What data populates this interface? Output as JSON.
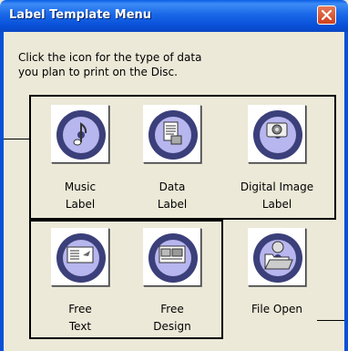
{
  "window": {
    "title": "Label Template Menu"
  },
  "instruction": [
    "Click the icon for the type of data",
    "you plan to print on the Disc."
  ],
  "buttons": [
    {
      "icon": "music-disc-icon",
      "label": [
        "Music",
        "Label"
      ]
    },
    {
      "icon": "data-disc-icon",
      "label": [
        "Data",
        "Label"
      ]
    },
    {
      "icon": "digital-image-disc-icon",
      "label": [
        "Digital Image",
        "Label"
      ]
    },
    {
      "icon": "free-text-disc-icon",
      "label": [
        "Free",
        "Text"
      ]
    },
    {
      "icon": "free-design-disc-icon",
      "label": [
        "Free",
        "Design"
      ]
    },
    {
      "icon": "file-open-disc-icon",
      "label": [
        "File Open",
        ""
      ]
    }
  ],
  "colors": {
    "titlebar": "#0a5fe6",
    "dialog_bg": "#ece9d8",
    "disc_dark": "#3b3f7a",
    "disc_light": "#b7b6ee"
  }
}
